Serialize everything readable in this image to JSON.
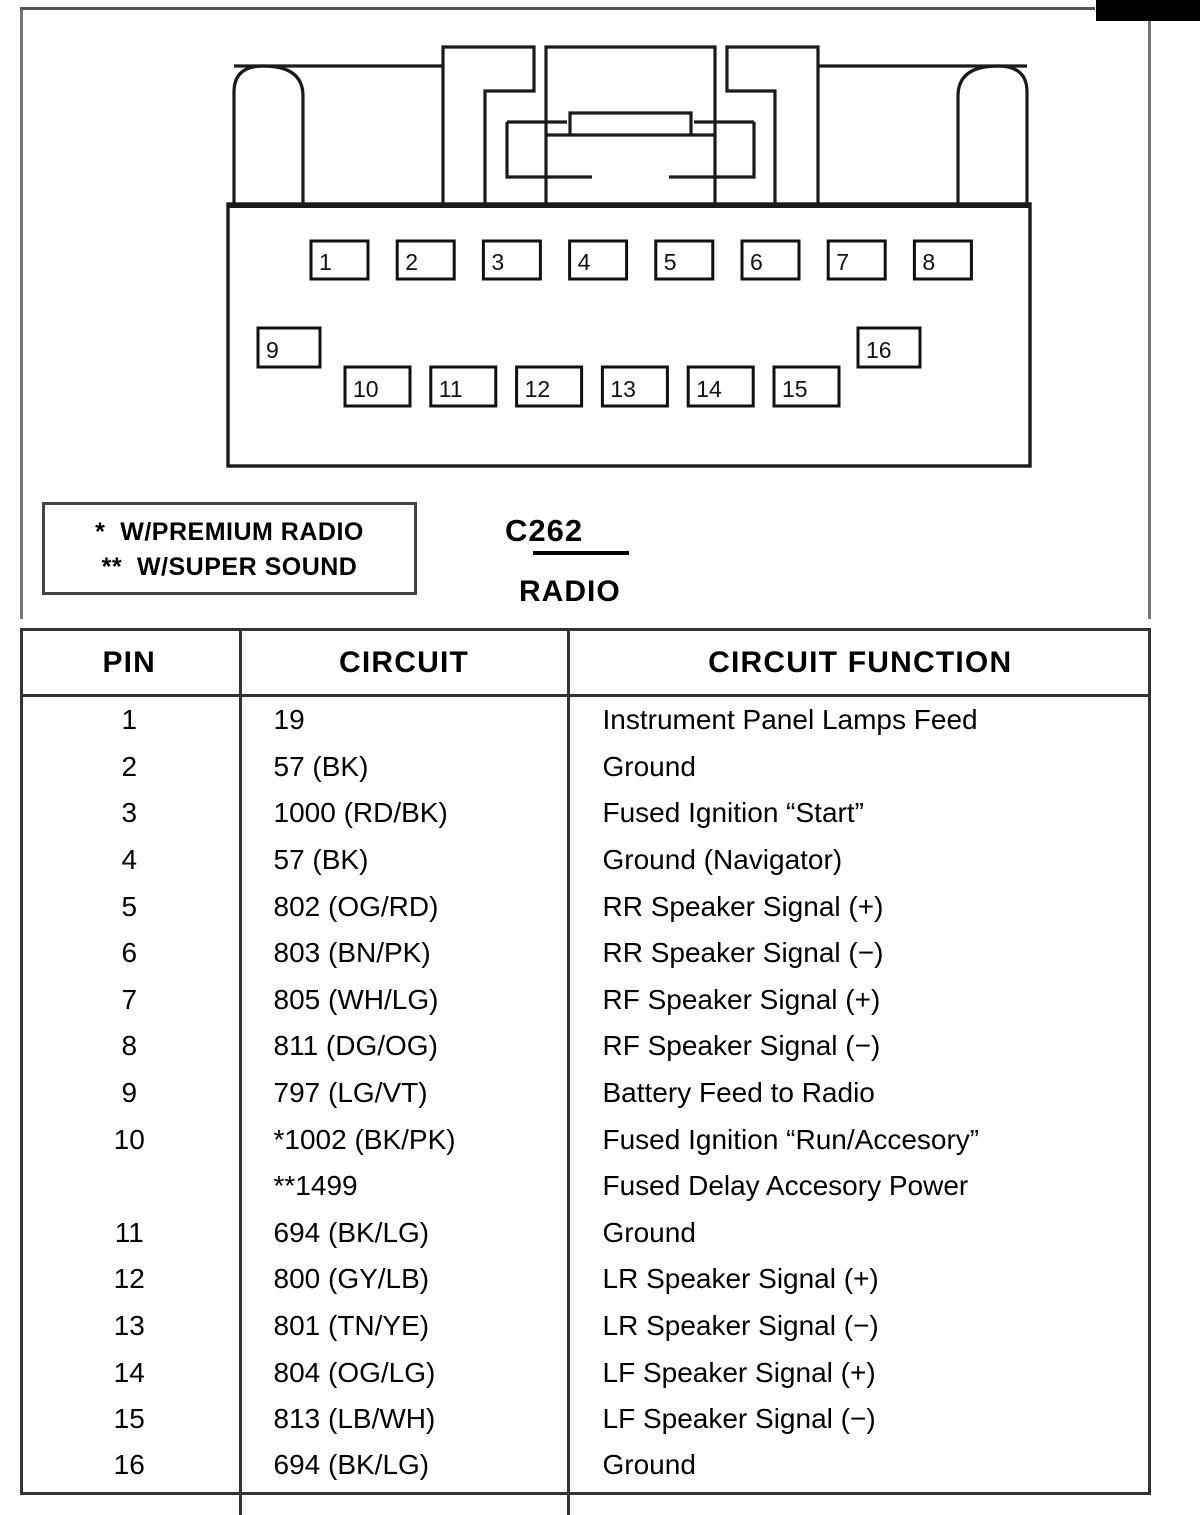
{
  "connector": {
    "id_label": "C262",
    "sub_label": "RADIO",
    "pins_row1": [
      "1",
      "2",
      "3",
      "4",
      "5",
      "6",
      "7",
      "8"
    ],
    "pin_9": "9",
    "pin_16": "16",
    "pins_row2": [
      "10",
      "11",
      "12",
      "13",
      "14",
      "15"
    ]
  },
  "legend": {
    "line1": "*  W/PREMIUM RADIO",
    "line2": "**  W/SUPER SOUND"
  },
  "table": {
    "headers": {
      "pin": "PIN",
      "circuit": "CIRCUIT",
      "function": "CIRCUIT FUNCTION"
    },
    "rows": [
      {
        "pin": "1",
        "circuit": "19",
        "function": "Instrument Panel Lamps Feed"
      },
      {
        "pin": "2",
        "circuit": "57 (BK)",
        "function": "Ground"
      },
      {
        "pin": "3",
        "circuit": "1000 (RD/BK)",
        "function": "Fused Ignition “Start”"
      },
      {
        "pin": "4",
        "circuit": "57 (BK)",
        "function": "Ground (Navigator)"
      },
      {
        "pin": "5",
        "circuit": "802 (OG/RD)",
        "function": "RR Speaker Signal (+)"
      },
      {
        "pin": "6",
        "circuit": "803 (BN/PK)",
        "function": "RR Speaker Signal (−)"
      },
      {
        "pin": "7",
        "circuit": "805 (WH/LG)",
        "function": "RF Speaker Signal (+)"
      },
      {
        "pin": "8",
        "circuit": "811 (DG/OG)",
        "function": "RF Speaker Signal (−)"
      },
      {
        "pin": "9",
        "circuit": "797 (LG/VT)",
        "function": "Battery Feed to Radio"
      },
      {
        "pin": "10",
        "circuit": "*1002 (BK/PK)",
        "function": "Fused Ignition “Run/Accesory”"
      },
      {
        "pin": "",
        "circuit": "**1499",
        "function": "Fused Delay  Accesory Power"
      },
      {
        "pin": "11",
        "circuit": "694 (BK/LG)",
        "function": "Ground"
      },
      {
        "pin": "12",
        "circuit": "800 (GY/LB)",
        "function": "LR Speaker Signal (+)"
      },
      {
        "pin": "13",
        "circuit": "801 (TN/YE)",
        "function": "LR Speaker Signal (−)"
      },
      {
        "pin": "14",
        "circuit": "804 (OG/LG)",
        "function": "LF Speaker Signal (+)"
      },
      {
        "pin": "15",
        "circuit": "813 (LB/WH)",
        "function": "LF Speaker Signal (−)"
      },
      {
        "pin": "16",
        "circuit": "694 (BK/LG)",
        "function": "Ground"
      }
    ]
  }
}
